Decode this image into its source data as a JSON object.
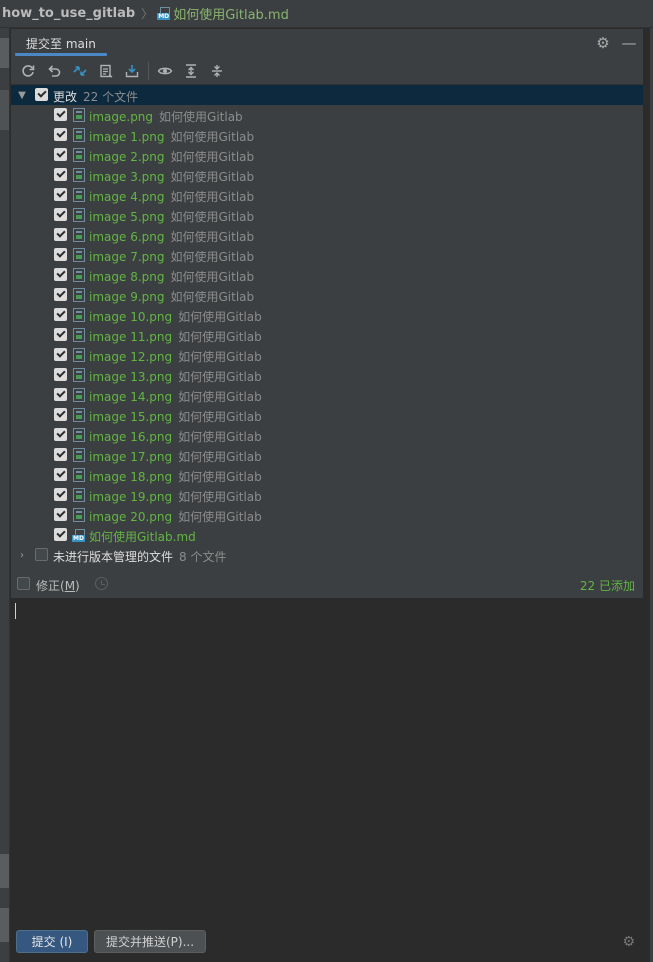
{
  "breadcrumb": {
    "project": "how_to_use_gitlab",
    "file": "如何使用Gitlab.md"
  },
  "header": {
    "tab_label": "提交至 main"
  },
  "toolbar": {
    "icons": [
      "refresh-icon",
      "rollback-icon",
      "diff-icon",
      "commit-message-history-icon",
      "shelve-icon",
      "eye-icon",
      "expand-all-icon",
      "collapse-all-icon"
    ]
  },
  "tree": {
    "changes_group": {
      "label": "更改",
      "count": "22 个文件"
    },
    "files": [
      {
        "name": "image.png",
        "path": "如何使用Gitlab"
      },
      {
        "name": "image 1.png",
        "path": "如何使用Gitlab"
      },
      {
        "name": "image 2.png",
        "path": "如何使用Gitlab"
      },
      {
        "name": "image 3.png",
        "path": "如何使用Gitlab"
      },
      {
        "name": "image 4.png",
        "path": "如何使用Gitlab"
      },
      {
        "name": "image 5.png",
        "path": "如何使用Gitlab"
      },
      {
        "name": "image 6.png",
        "path": "如何使用Gitlab"
      },
      {
        "name": "image 7.png",
        "path": "如何使用Gitlab"
      },
      {
        "name": "image 8.png",
        "path": "如何使用Gitlab"
      },
      {
        "name": "image 9.png",
        "path": "如何使用Gitlab"
      },
      {
        "name": "image 10.png",
        "path": "如何使用Gitlab"
      },
      {
        "name": "image 11.png",
        "path": "如何使用Gitlab"
      },
      {
        "name": "image 12.png",
        "path": "如何使用Gitlab"
      },
      {
        "name": "image 13.png",
        "path": "如何使用Gitlab"
      },
      {
        "name": "image 14.png",
        "path": "如何使用Gitlab"
      },
      {
        "name": "image 15.png",
        "path": "如何使用Gitlab"
      },
      {
        "name": "image 16.png",
        "path": "如何使用Gitlab"
      },
      {
        "name": "image 17.png",
        "path": "如何使用Gitlab"
      },
      {
        "name": "image 18.png",
        "path": "如何使用Gitlab"
      },
      {
        "name": "image 19.png",
        "path": "如何使用Gitlab"
      },
      {
        "name": "image 20.png",
        "path": "如何使用Gitlab"
      },
      {
        "name": "如何使用Gitlab.md",
        "path": ""
      }
    ],
    "unversioned_group": {
      "label": "未进行版本管理的文件",
      "count": "8 个文件"
    }
  },
  "amend": {
    "label_prefix": "修正(",
    "mnemonic": "M",
    "label_suffix": ")",
    "status": "22 已添加"
  },
  "buttons": {
    "commit": "提交 (I)",
    "commit_push": "提交并推送(P)..."
  },
  "colors": {
    "added_green": "#62b543",
    "accent_blue": "#4a88c7",
    "selection": "#0d293e"
  }
}
